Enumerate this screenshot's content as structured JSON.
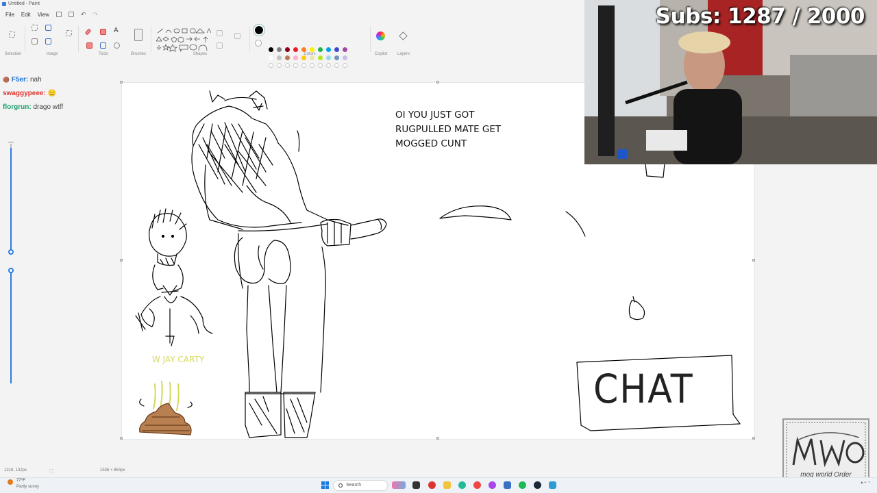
{
  "window": {
    "title": "Untitled - Paint"
  },
  "menu": {
    "file": "File",
    "edit": "Edit",
    "view": "View"
  },
  "ribbon": {
    "groups": [
      {
        "label": "Selection"
      },
      {
        "label": "Image"
      },
      {
        "label": "Tools"
      },
      {
        "label": "Brushes"
      },
      {
        "label": "Shapes"
      },
      {
        "label": "Colors"
      },
      {
        "label": "Copilot"
      },
      {
        "label": "Layers"
      }
    ],
    "palette_row1": [
      "#000000",
      "#7f7f7f",
      "#880015",
      "#ed1c24",
      "#ff7f27",
      "#fff200",
      "#22b14c",
      "#00a2e8",
      "#3f48cc",
      "#a349a4"
    ],
    "palette_row2": [
      "#ffffff",
      "#c3c3c3",
      "#b97a57",
      "#ffaec9",
      "#ffc90e",
      "#efe4b0",
      "#b5e61d",
      "#99d9ea",
      "#7092be",
      "#c8bfe7"
    ],
    "current_color": "#000000"
  },
  "chat": [
    {
      "user": "F5er:",
      "message": "nah",
      "color": "#1e73d6"
    },
    {
      "user": "swaggypeee:",
      "message": "😐",
      "color": "#e0332b"
    },
    {
      "user": "florgrun:",
      "message": "drago wtff",
      "color": "#1aa06b"
    }
  ],
  "canvas": {
    "caption_lines": [
      "OI YOU JUST GOT",
      "RUGPULLED MATE GET",
      "MOGGED CUNT"
    ],
    "left_caption": "W JAY CARTY",
    "chat_box": "CHAT"
  },
  "stream": {
    "subs": "Subs: 1287 / 2000"
  },
  "watermark": {
    "text": "mog world Order",
    "big": "mWo"
  },
  "statusbar": {
    "position": "1318, 132px",
    "size": "1536 × 864px"
  },
  "taskbar": {
    "weather_temp": "77°F",
    "weather_desc": "Partly sunny",
    "search_label": "Search"
  },
  "colors": {
    "accent": "#2d7be0",
    "canvas": "#ffffff",
    "caption_yellow": "#d6d85a"
  }
}
